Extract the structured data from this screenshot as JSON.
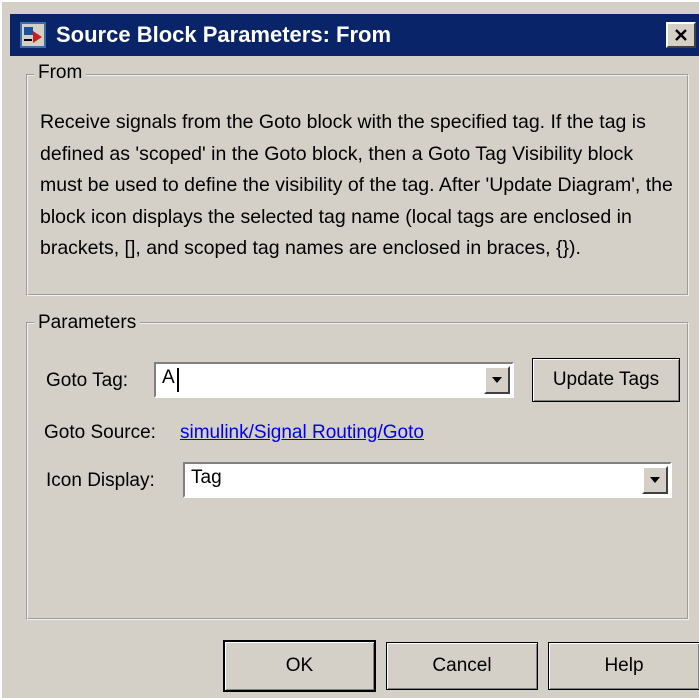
{
  "window": {
    "title": "Source Block Parameters: From"
  },
  "from_group": {
    "title": "From",
    "description": "Receive signals from the Goto block with the specified tag.  If the tag is defined as 'scoped' in the Goto block, then a Goto Tag Visibility block must be used to define the visibility of the tag. After 'Update Diagram', the block icon displays the selected tag name  (local tags are enclosed in brackets, [], and scoped tag names are enclosed in braces, {})."
  },
  "params_group": {
    "title": "Parameters",
    "goto_tag_label": "Goto Tag:",
    "goto_tag_value": "A",
    "update_tags_label": "Update Tags",
    "goto_source_label": "Goto Source:",
    "goto_source_link": "simulink/Signal Routing/Goto",
    "icon_display_label": "Icon Display:",
    "icon_display_value": "Tag"
  },
  "buttons": {
    "ok": "OK",
    "cancel": "Cancel",
    "help": "Help"
  },
  "colors": {
    "titlebar": "#0a246a",
    "dialog_bg": "#d4d0c8",
    "link": "#0000ee"
  },
  "icons": [
    "simulink-block-icon",
    "close-icon",
    "dropdown-arrow-icon"
  ]
}
